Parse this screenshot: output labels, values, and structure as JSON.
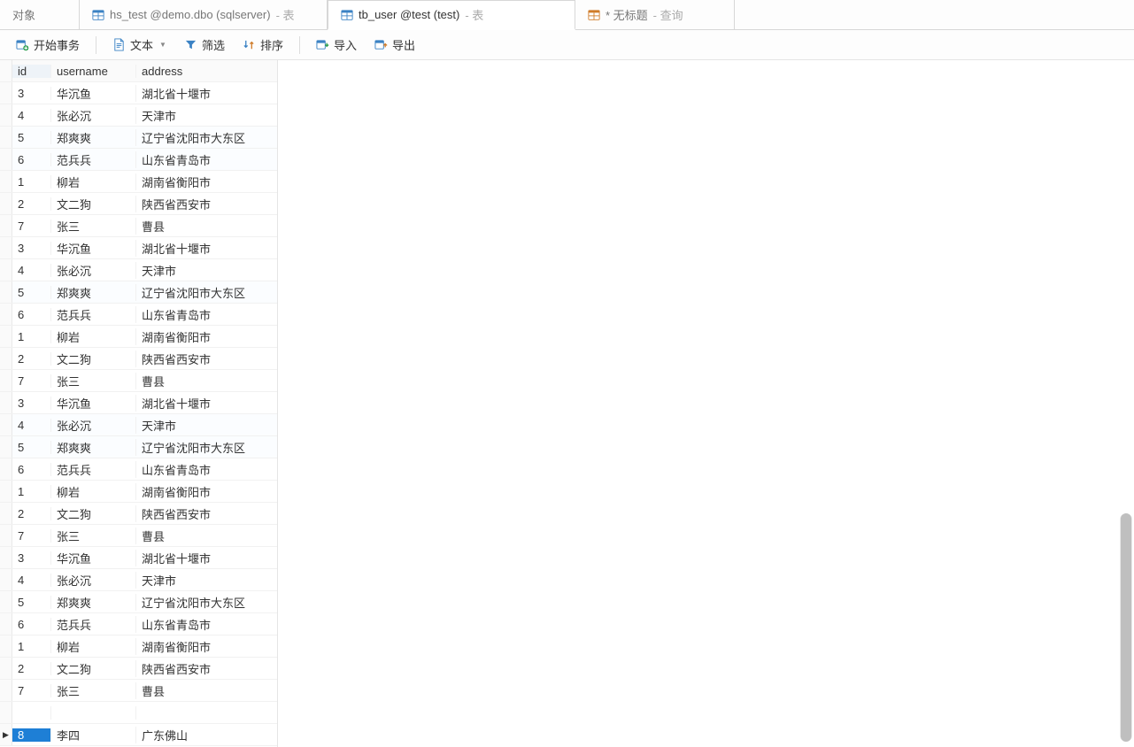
{
  "tabs": [
    {
      "label": "对象",
      "suffix": "",
      "icon": "none"
    },
    {
      "label": "hs_test @demo.dbo (sqlserver)",
      "suffix": " - 表",
      "icon": "table"
    },
    {
      "label": "tb_user @test (test)",
      "suffix": " - 表",
      "icon": "table"
    },
    {
      "label": "* 无标题",
      "suffix": " - 查询",
      "icon": "query"
    }
  ],
  "toolbar": {
    "begin_tx": "开始事务",
    "text": "文本",
    "filter": "筛选",
    "sort": "排序",
    "import": "导入",
    "export": "导出"
  },
  "columns": {
    "id": "id",
    "username": "username",
    "address": "address"
  },
  "rows": [
    {
      "id": "3",
      "username": "华沉鱼",
      "address": "湖北省十堰市"
    },
    {
      "id": "4",
      "username": "张必沉",
      "address": "天津市"
    },
    {
      "id": "5",
      "username": "郑爽爽",
      "address": "辽宁省沈阳市大东区"
    },
    {
      "id": "6",
      "username": "范兵兵",
      "address": "山东省青岛市"
    },
    {
      "id": "1",
      "username": "柳岩",
      "address": "湖南省衡阳市"
    },
    {
      "id": "2",
      "username": "文二狗",
      "address": "陕西省西安市"
    },
    {
      "id": "7",
      "username": "张三",
      "address": "曹县"
    },
    {
      "id": "3",
      "username": "华沉鱼",
      "address": "湖北省十堰市"
    },
    {
      "id": "4",
      "username": "张必沉",
      "address": "天津市"
    },
    {
      "id": "5",
      "username": "郑爽爽",
      "address": "辽宁省沈阳市大东区"
    },
    {
      "id": "6",
      "username": "范兵兵",
      "address": "山东省青岛市"
    },
    {
      "id": "1",
      "username": "柳岩",
      "address": "湖南省衡阳市"
    },
    {
      "id": "2",
      "username": "文二狗",
      "address": "陕西省西安市"
    },
    {
      "id": "7",
      "username": "张三",
      "address": "曹县"
    },
    {
      "id": "3",
      "username": "华沉鱼",
      "address": "湖北省十堰市"
    },
    {
      "id": "4",
      "username": "张必沉",
      "address": "天津市"
    },
    {
      "id": "5",
      "username": "郑爽爽",
      "address": "辽宁省沈阳市大东区"
    },
    {
      "id": "6",
      "username": "范兵兵",
      "address": "山东省青岛市"
    },
    {
      "id": "1",
      "username": "柳岩",
      "address": "湖南省衡阳市"
    },
    {
      "id": "2",
      "username": "文二狗",
      "address": "陕西省西安市"
    },
    {
      "id": "7",
      "username": "张三",
      "address": "曹县"
    },
    {
      "id": "3",
      "username": "华沉鱼",
      "address": "湖北省十堰市"
    },
    {
      "id": "4",
      "username": "张必沉",
      "address": "天津市"
    },
    {
      "id": "5",
      "username": "郑爽爽",
      "address": "辽宁省沈阳市大东区"
    },
    {
      "id": "6",
      "username": "范兵兵",
      "address": "山东省青岛市"
    },
    {
      "id": "1",
      "username": "柳岩",
      "address": "湖南省衡阳市"
    },
    {
      "id": "2",
      "username": "文二狗",
      "address": "陕西省西安市"
    },
    {
      "id": "7",
      "username": "张三",
      "address": "曹县"
    }
  ],
  "current_row": {
    "id": "8",
    "username": "李四",
    "address": "广东佛山"
  }
}
